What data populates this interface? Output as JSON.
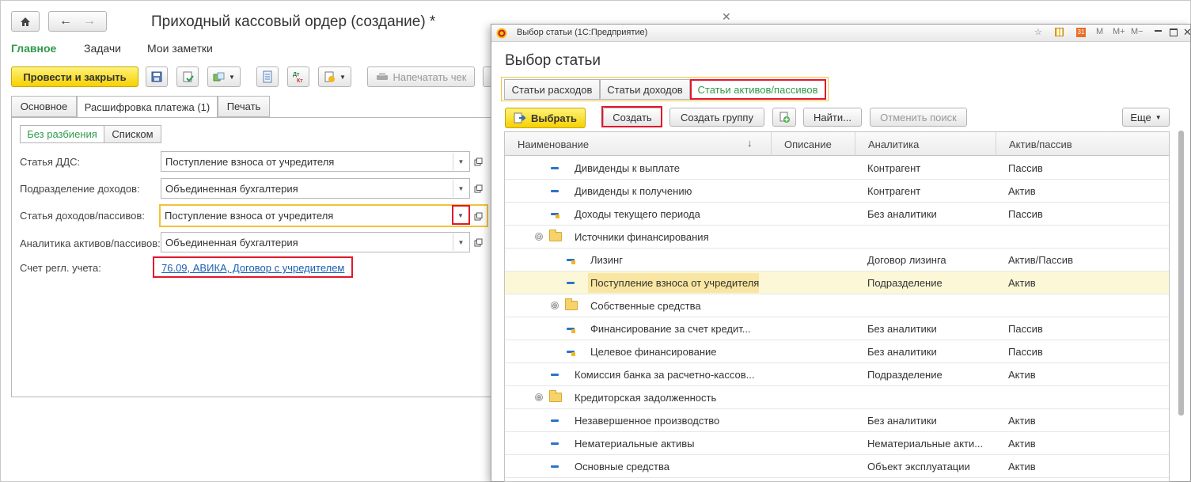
{
  "main": {
    "title": "Приходный кассовый ордер (создание) *",
    "nav": [
      "Главное",
      "Задачи",
      "Мои заметки"
    ],
    "toolbar": {
      "post_close": "Провести и закрыть",
      "print_receipt": "Напечатать чек"
    },
    "tabs": [
      "Основное",
      "Расшифровка платежа (1)",
      "Печать"
    ],
    "split_modes": [
      "Без разбиения",
      "Списком"
    ],
    "fields": [
      {
        "label": "Статья ДДС:",
        "value": "Поступление взноса от учредителя"
      },
      {
        "label": "Подразделение доходов:",
        "value": "Объединенная бухгалтерия"
      },
      {
        "label": "Статья доходов/пассивов:",
        "value": "Поступление взноса от учредителя"
      },
      {
        "label": "Аналитика активов/пассивов:",
        "value": "Объединенная бухгалтерия"
      }
    ],
    "account_label": "Счет регл. учета:",
    "account_link": "76.09, АВИКА, Договор с учредителем"
  },
  "dialog": {
    "window_title": "Выбор статьи (1С:Предприятие)",
    "heading": "Выбор статьи",
    "tb_glyphs": [
      "M",
      "M+",
      "M−"
    ],
    "tabs": [
      "Статьи расходов",
      "Статьи доходов",
      "Статьи активов/пассивов"
    ],
    "toolbar": {
      "select": "Выбрать",
      "create": "Создать",
      "create_group": "Создать группу",
      "find": "Найти...",
      "cancel_search": "Отменить поиск",
      "more": "Еще"
    },
    "columns": [
      "Наименование",
      "Описание",
      "Аналитика",
      "Актив/пассив"
    ],
    "rows": [
      {
        "name": "Дивиденды к выплате",
        "analytics": "Контрагент",
        "type": "Пассив"
      },
      {
        "name": "Дивиденды к получению",
        "analytics": "Контрагент",
        "type": "Актив"
      },
      {
        "name": "Доходы текущего периода",
        "analytics": "Без аналитики",
        "type": "Пассив"
      },
      {
        "name": "Источники финансирования",
        "analytics": "",
        "type": ""
      },
      {
        "name": "Лизинг",
        "analytics": "Договор лизинга",
        "type": "Актив/Пассив"
      },
      {
        "name": "Поступление взноса от учредителя",
        "analytics": "Подразделение",
        "type": "Актив"
      },
      {
        "name": "Собственные средства",
        "analytics": "",
        "type": ""
      },
      {
        "name": "Финансирование за счет кредит...",
        "analytics": "Без аналитики",
        "type": "Пассив"
      },
      {
        "name": "Целевое финансирование",
        "analytics": "Без аналитики",
        "type": "Пассив"
      },
      {
        "name": "Комиссия банка за расчетно-кассов...",
        "analytics": "Подразделение",
        "type": "Актив"
      },
      {
        "name": "Кредиторская задолженность",
        "analytics": "",
        "type": ""
      },
      {
        "name": "Незавершенное производство",
        "analytics": "Без аналитики",
        "type": "Актив"
      },
      {
        "name": "Нематериальные активы",
        "analytics": "Нематериальные акти...",
        "type": "Актив"
      },
      {
        "name": "Основные средства",
        "analytics": "Объект эксплуатации",
        "type": "Актив"
      }
    ]
  }
}
